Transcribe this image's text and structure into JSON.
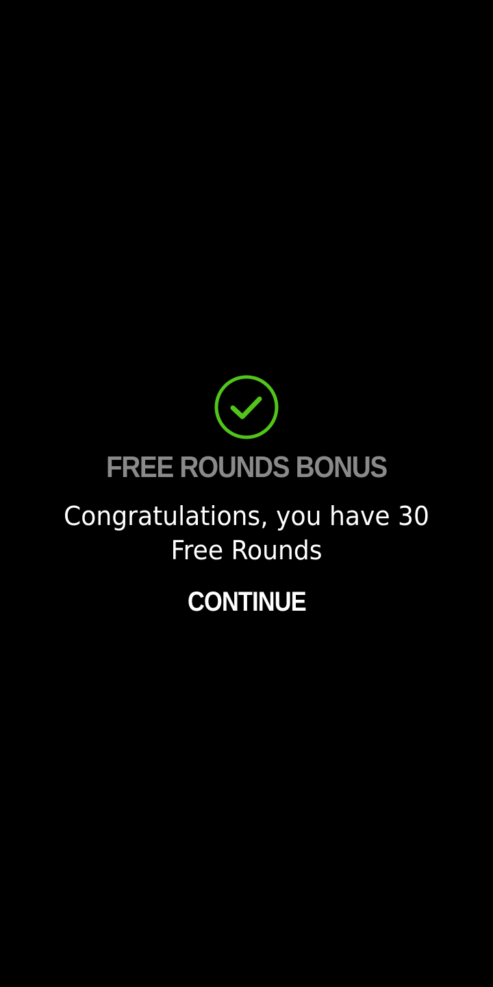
{
  "dialog": {
    "icon": "checkmark-circle-icon",
    "title": "FREE ROUNDS BONUS",
    "message": "Congratulations, you have 30 Free Rounds",
    "continue_label": "CONTINUE"
  },
  "colors": {
    "background": "#000000",
    "accent": "#52c41a",
    "title": "#8a8a8a",
    "text": "#ffffff"
  }
}
